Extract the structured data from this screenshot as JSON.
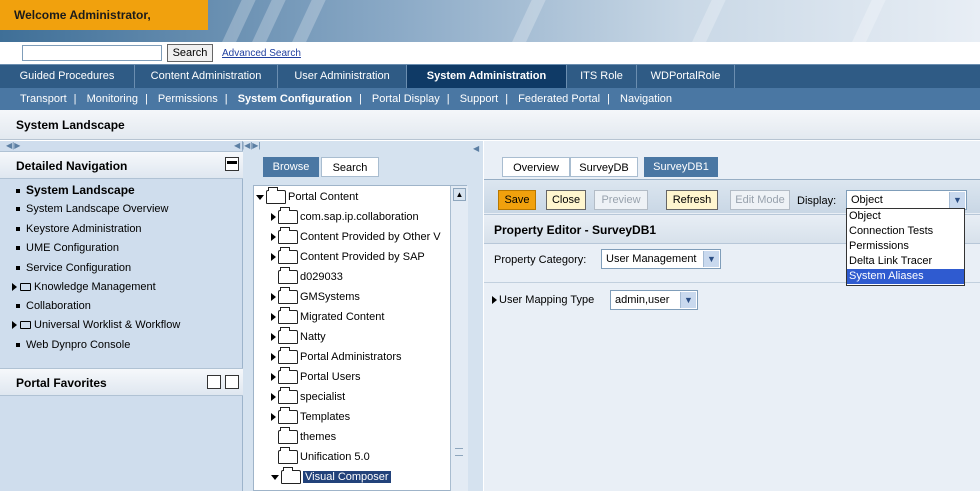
{
  "header": {
    "welcome": "Welcome Administrator,"
  },
  "search": {
    "value": "",
    "button_label": "Search",
    "advanced_label": "Advanced Search"
  },
  "topnav": {
    "tabs": [
      {
        "label": "Guided Procedures"
      },
      {
        "label": "Content Administration"
      },
      {
        "label": "User Administration"
      },
      {
        "label": "System Administration",
        "active": true
      },
      {
        "label": "ITS Role"
      },
      {
        "label": "WDPortalRole"
      }
    ]
  },
  "subnav": {
    "items": [
      {
        "label": "Transport"
      },
      {
        "label": "Monitoring"
      },
      {
        "label": "Permissions"
      },
      {
        "label": "System Configuration",
        "active": true
      },
      {
        "label": "Portal Display"
      },
      {
        "label": "Support"
      },
      {
        "label": "Federated Portal"
      },
      {
        "label": "Navigation"
      }
    ]
  },
  "page": {
    "title": "System Landscape"
  },
  "leftnav": {
    "detailed_nav_title": "Detailed Navigation",
    "items": [
      {
        "label": "System Landscape",
        "type": "bullet",
        "selected": true
      },
      {
        "label": "System Landscape Overview",
        "type": "bullet"
      },
      {
        "label": "Keystore Administration",
        "type": "bullet"
      },
      {
        "label": "UME Configuration",
        "type": "bullet"
      },
      {
        "label": "Service Configuration",
        "type": "bullet"
      },
      {
        "label": "Knowledge Management",
        "type": "folder"
      },
      {
        "label": "Collaboration",
        "type": "bullet"
      },
      {
        "label": "Universal Worklist & Workflow",
        "type": "folder"
      },
      {
        "label": "Web Dynpro Console",
        "type": "bullet"
      }
    ],
    "favorites_title": "Portal Favorites"
  },
  "browser": {
    "tabs": [
      {
        "label": "Browse"
      },
      {
        "label": "Search"
      }
    ],
    "tree": [
      {
        "label": "Portal Content",
        "expanded": true,
        "level": 0
      },
      {
        "label": "com.sap.ip.collaboration",
        "level": 1,
        "expandable": true
      },
      {
        "label": "Content Provided by Other V",
        "level": 1,
        "expandable": true
      },
      {
        "label": "Content Provided by SAP",
        "level": 1,
        "expandable": true
      },
      {
        "label": "d029033",
        "level": 1,
        "expandable": false
      },
      {
        "label": "GMSystems",
        "level": 1,
        "expandable": true
      },
      {
        "label": "Migrated Content",
        "level": 1,
        "expandable": true
      },
      {
        "label": "Natty",
        "level": 1,
        "expandable": true
      },
      {
        "label": "Portal Administrators",
        "level": 1,
        "expandable": true
      },
      {
        "label": "Portal Users",
        "level": 1,
        "expandable": true
      },
      {
        "label": "specialist",
        "level": 1,
        "expandable": true
      },
      {
        "label": "Templates",
        "level": 1,
        "expandable": true
      },
      {
        "label": "themes",
        "level": 1,
        "expandable": false
      },
      {
        "label": "Unification 5.0",
        "level": 1,
        "expandable": false
      },
      {
        "label": "Visual Composer",
        "level": 1,
        "expandable": true,
        "expanded": true,
        "selected": true
      }
    ]
  },
  "editor": {
    "tabs": [
      {
        "label": "Overview"
      },
      {
        "label": "SurveyDB"
      },
      {
        "label": "SurveyDB1",
        "active": true
      }
    ],
    "toolbar": {
      "save": "Save",
      "close": "Close",
      "preview": "Preview",
      "refresh": "Refresh",
      "edit_mode": "Edit Mode",
      "display_label": "Display:",
      "display_value": "Object"
    },
    "display_options": [
      "Object",
      "Connection Tests",
      "Permissions",
      "Delta Link Tracer",
      "System Aliases"
    ],
    "display_highlighted": "System Aliases",
    "property_editor_title": "Property Editor - SurveyDB1",
    "property_category_label": "Property Category:",
    "property_category_value": "User Management",
    "user_mapping_label": "User Mapping Type",
    "user_mapping_value": "admin,user"
  }
}
